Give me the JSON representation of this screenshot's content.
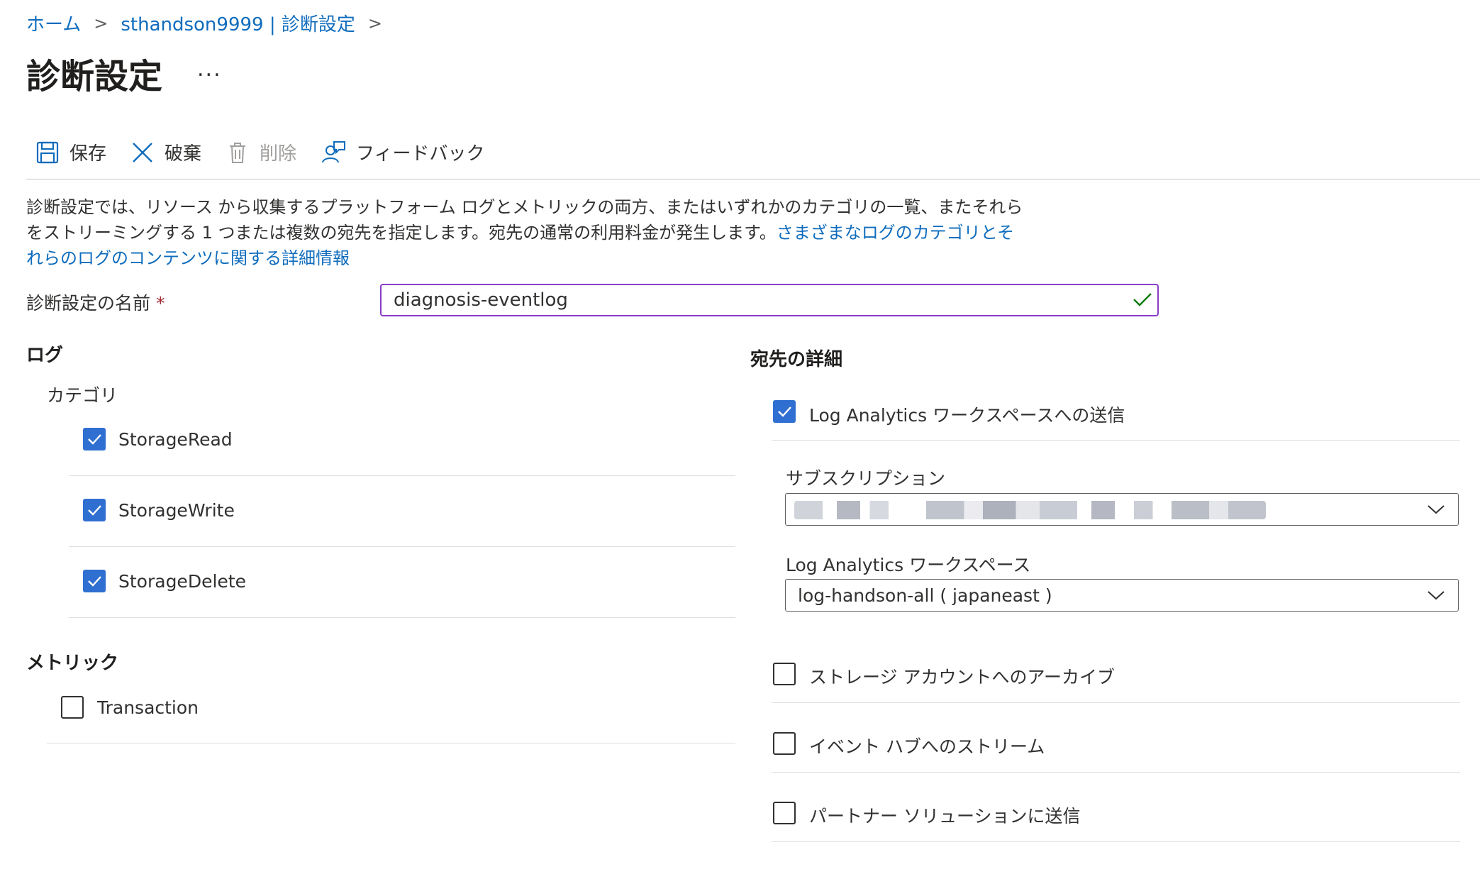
{
  "breadcrumb": {
    "home": "ホーム",
    "resource": "sthandson9999 | 診断設定"
  },
  "page_title": "診断設定",
  "more_label": "...",
  "toolbar": {
    "save": "保存",
    "discard": "破棄",
    "delete": "削除",
    "feedback": "フィードバック"
  },
  "description": {
    "text": "診断設定では、リソース から収集するプラットフォーム ログとメトリックの両方、またはいずれかのカテゴリの一覧、またそれらをストリーミングする 1 つまたは複数の宛先を指定します。宛先の通常の利用料金が発生します。",
    "link": "さまざまなログのカテゴリとそれらのログのコンテンツに関する詳細情報"
  },
  "name_field": {
    "label": "診断設定の名前",
    "required_mark": "*",
    "value": "diagnosis-eventlog",
    "valid": true
  },
  "logs": {
    "heading": "ログ",
    "category_label": "カテゴリ",
    "categories": [
      {
        "label": "StorageRead",
        "checked": true
      },
      {
        "label": "StorageWrite",
        "checked": true
      },
      {
        "label": "StorageDelete",
        "checked": true
      }
    ]
  },
  "metrics": {
    "heading": "メトリック",
    "items": [
      {
        "label": "Transaction",
        "checked": false
      }
    ]
  },
  "destination": {
    "heading": "宛先の詳細",
    "log_analytics": {
      "label": "Log Analytics ワークスペースへの送信",
      "checked": true
    },
    "subscription": {
      "label": "サブスクリプション",
      "value_redacted": true
    },
    "workspace": {
      "label": "Log Analytics ワークスペース",
      "value": "log-handson-all ( japaneast )"
    },
    "others": [
      {
        "label": "ストレージ アカウントへのアーカイブ",
        "checked": false
      },
      {
        "label": "イベント ハブへのストリーム",
        "checked": false
      },
      {
        "label": "パートナー ソリューションに送信",
        "checked": false
      }
    ]
  },
  "colors": {
    "accent": "#2f6fd1",
    "link": "#0f6cbd",
    "focus_border": "#8a3cc8",
    "valid": "#107c10"
  }
}
